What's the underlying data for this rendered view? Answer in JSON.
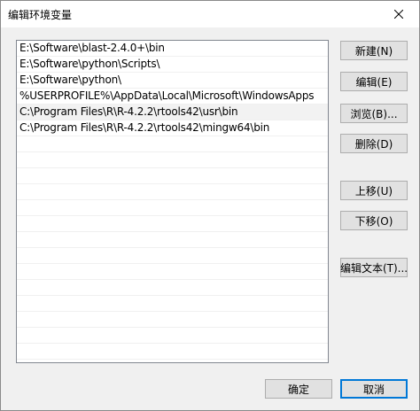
{
  "window": {
    "title": "编辑环境变量"
  },
  "paths": [
    "E:\\Software\\blast-2.4.0+\\bin",
    "E:\\Software\\python\\Scripts\\",
    "E:\\Software\\python\\",
    "%USERPROFILE%\\AppData\\Local\\Microsoft\\WindowsApps",
    "C:\\Program Files\\R\\R-4.2.2\\rtools42\\usr\\bin",
    "C:\\Program Files\\R\\R-4.2.2\\rtools42\\mingw64\\bin"
  ],
  "selected_index": 4,
  "buttons": {
    "new": "新建(N)",
    "edit": "编辑(E)",
    "browse": "浏览(B)...",
    "delete": "删除(D)",
    "move_up": "上移(U)",
    "move_down": "下移(O)",
    "edit_text": "编辑文本(T)..."
  },
  "footer": {
    "ok": "确定",
    "cancel": "取消"
  },
  "icons": {
    "close": "close-icon"
  }
}
